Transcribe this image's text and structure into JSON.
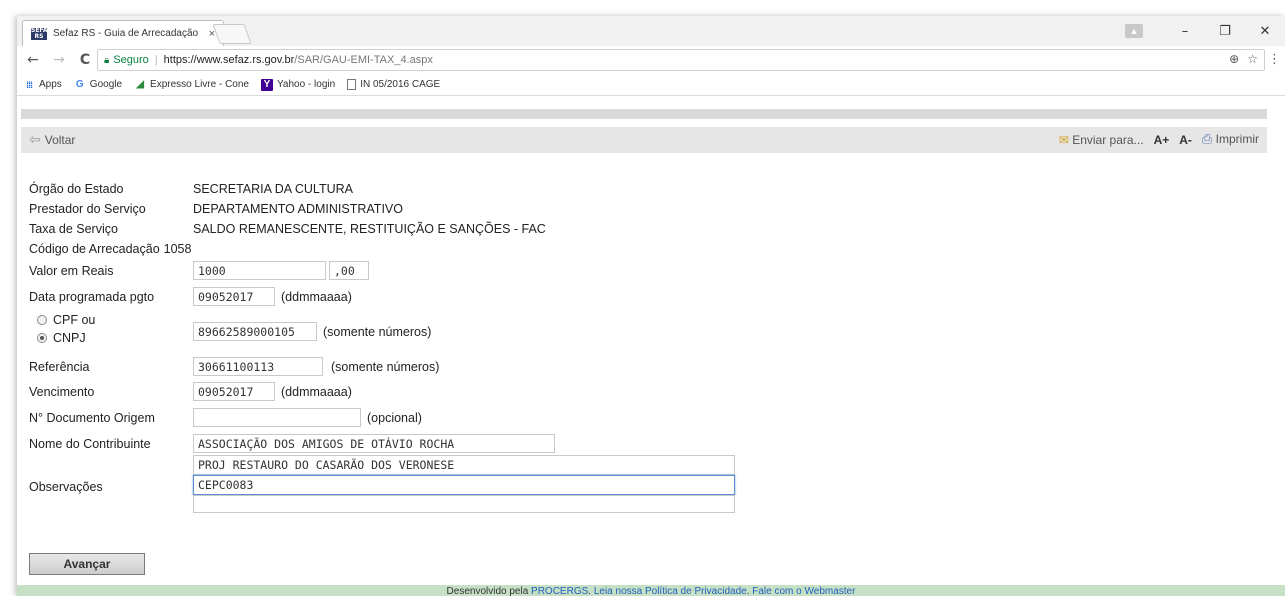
{
  "browser": {
    "tab_title": "Sefaz RS - Guia de Arrecadação",
    "tab_close": "×",
    "window_controls": {
      "minimize": "–",
      "restore": "❐",
      "close": "✕"
    },
    "nav": {
      "back": "←",
      "forward": "→",
      "reload": "C"
    },
    "address": {
      "secure_label": "Seguro",
      "url_host": "https://www.sefaz.rs.gov.br",
      "url_path": "/SAR/GAU-EMI-TAX_4.aspx"
    },
    "bookmarks": [
      {
        "label": "Apps",
        "icon": "apps-icon"
      },
      {
        "label": "Google",
        "icon": "google-icon"
      },
      {
        "label": "Expresso Livre - Cone",
        "icon": "expresso-icon"
      },
      {
        "label": "Yahoo - login",
        "icon": "yahoo-icon"
      },
      {
        "label": "IN 05/2016 CAGE",
        "icon": "page-icon"
      }
    ]
  },
  "toolbar": {
    "voltar": "Voltar",
    "enviar": "Enviar para...",
    "font_up": "A+",
    "font_down": "A-",
    "imprimir": "Imprimir"
  },
  "form": {
    "orgao": {
      "label": "Órgão do Estado",
      "value": "SECRETARIA DA CULTURA"
    },
    "prestador": {
      "label": "Prestador do Serviço",
      "value": "DEPARTAMENTO ADMINISTRATIVO"
    },
    "taxa": {
      "label": "Taxa de Serviço",
      "value": "SALDO REMANESCENTE, RESTITUIÇÃO E SANÇÕES - FAC"
    },
    "codigo": {
      "label": "Código de Arrecadação",
      "value": "1058"
    },
    "valor": {
      "label": "Valor em Reais",
      "reais": "1000",
      "centavos": ",00"
    },
    "data_pgto": {
      "label": "Data programada pgto",
      "value": "09052017",
      "hint": "(ddmmaaaa)"
    },
    "doc_type": {
      "cpf": "CPF ou",
      "cnpj": "CNPJ",
      "selected": "CNPJ",
      "value": "89662589000105",
      "hint": "(somente números)"
    },
    "referencia": {
      "label": "Referência",
      "value": "30661100113",
      "hint": "(somente números)"
    },
    "vencimento": {
      "label": "Vencimento",
      "value": "09052017",
      "hint": "(ddmmaaaa)"
    },
    "doc_origem": {
      "label": "N° Documento Origem",
      "value": "",
      "hint": "(opcional)"
    },
    "contribuinte": {
      "label": "Nome do Contribuinte",
      "value": "ASSOCIAÇÃO DOS AMIGOS DE OTÁVIO ROCHA"
    },
    "observacoes": {
      "label": "Observações",
      "lines": [
        "PROJ RESTAURO DO CASARÃO DOS VERONESE",
        "CEPC0083",
        ""
      ]
    },
    "submit": "Avançar"
  },
  "footer": {
    "prefix": "Desenvolvido pela ",
    "procergs": "PROCERGS",
    "sep1": ". ",
    "leia": "Leia nossa Política de Privacidade",
    "sep2": ". ",
    "fale": "Fale com o Webmaster"
  }
}
